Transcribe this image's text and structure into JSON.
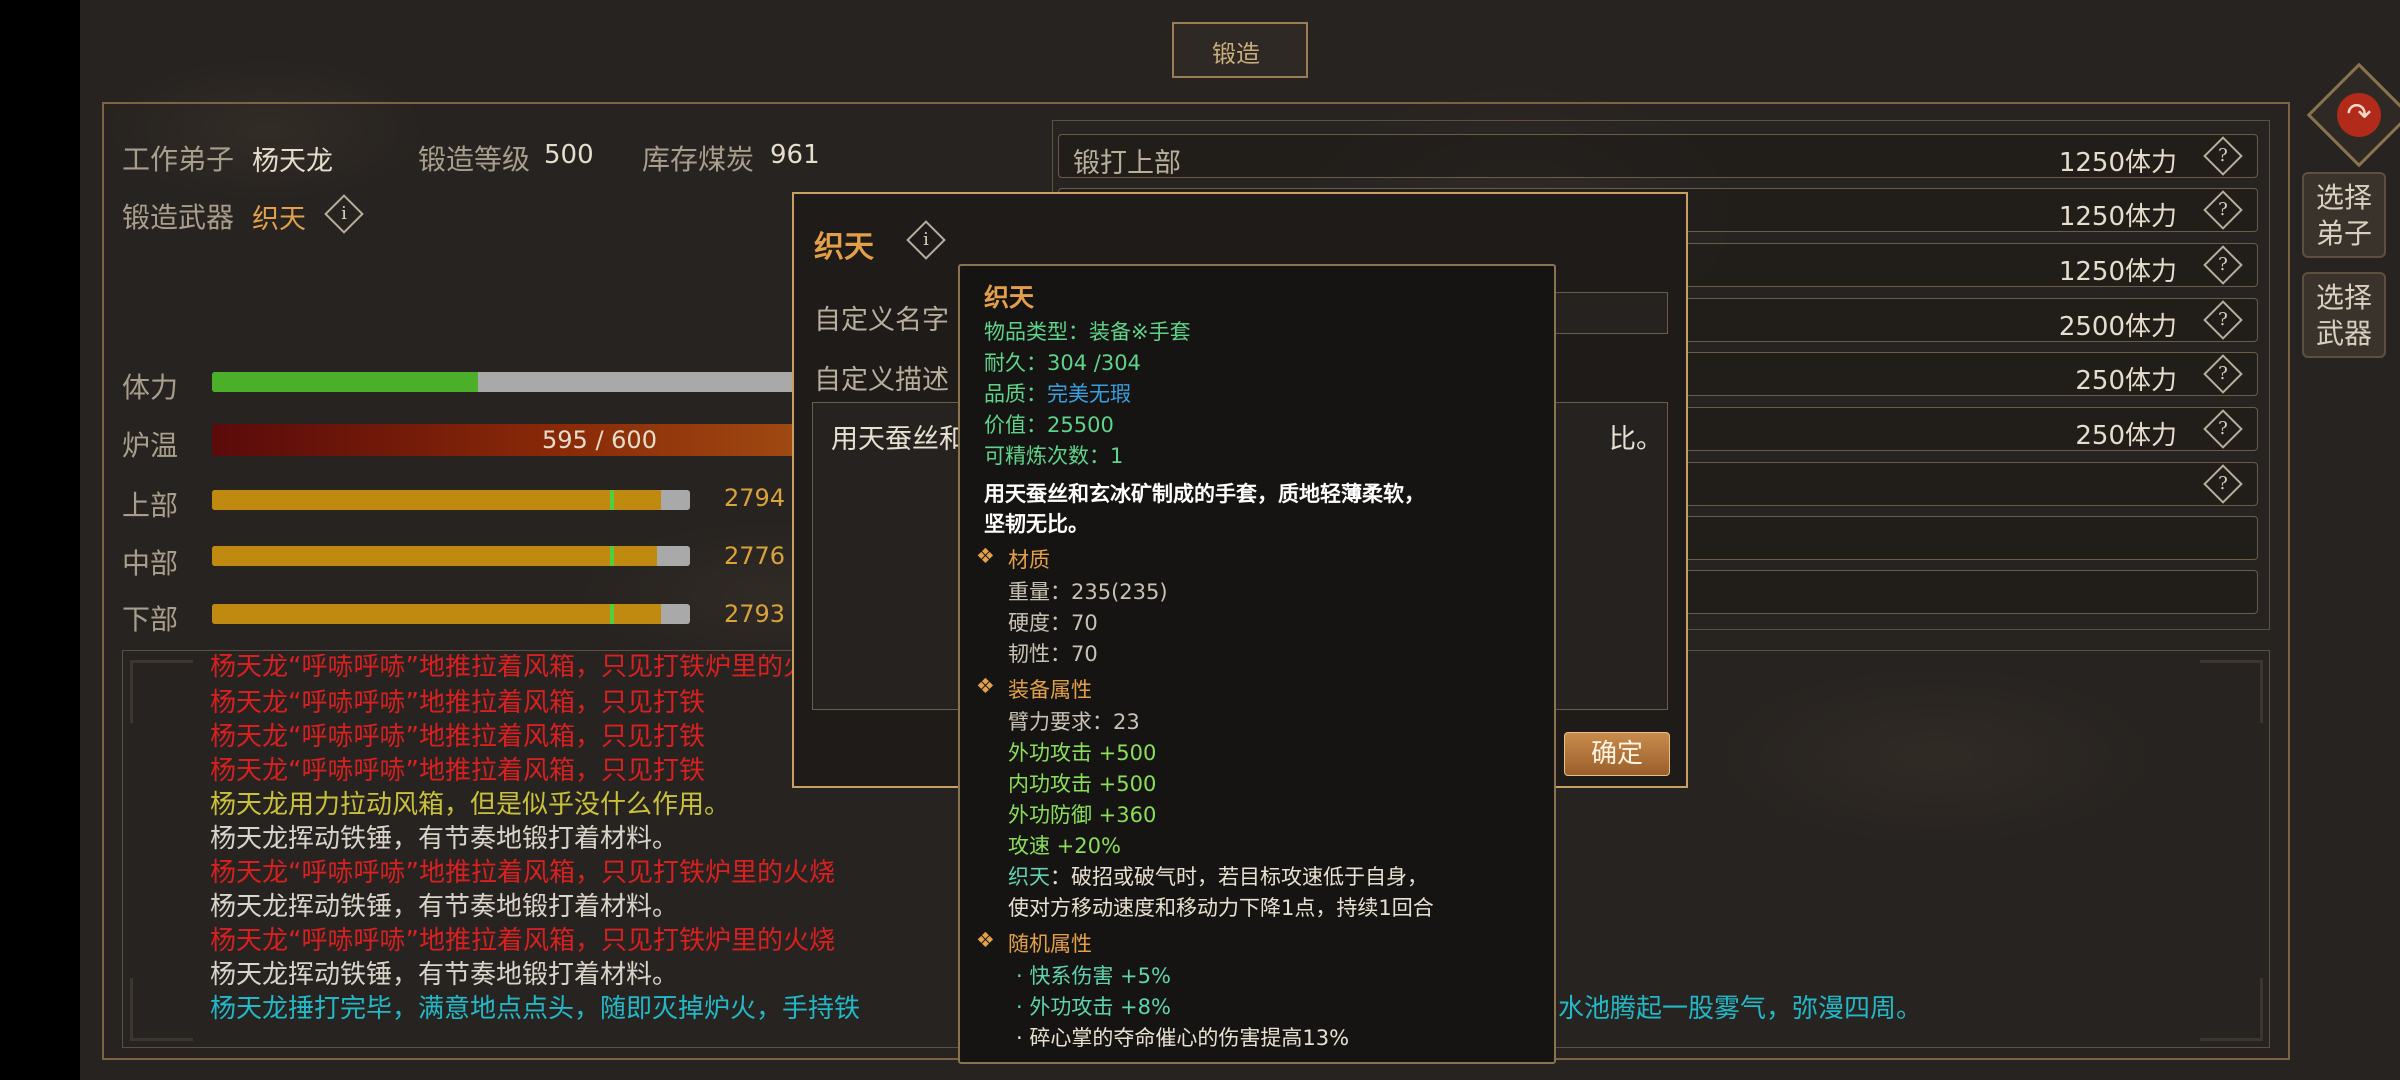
{
  "header": {
    "title": "锻造"
  },
  "info": {
    "worker_label": "工作弟子",
    "worker_value": "杨天龙",
    "level_label": "锻造等级",
    "level_value": "500",
    "coal_label": "库存煤炭",
    "coal_value": "961",
    "weapon_label": "锻造武器",
    "weapon_value": "织天"
  },
  "stats": {
    "stamina": {
      "label": "体力",
      "fraction": 0.45
    },
    "furnace": {
      "label": "炉温",
      "text": "595 / 600",
      "current": 595,
      "max": 600
    },
    "upper": {
      "label": "上部",
      "value": "2794",
      "fraction": 0.94
    },
    "middle": {
      "label": "中部",
      "value": "2776",
      "fraction": 0.93
    },
    "lower": {
      "label": "下部",
      "value": "2793",
      "fraction": 0.94
    }
  },
  "recipes": [
    {
      "name": "锻打上部",
      "cost": "1250体力"
    },
    {
      "name": "",
      "cost": "1250体力"
    },
    {
      "name": "",
      "cost": "1250体力"
    },
    {
      "name": "",
      "cost": "2500体力"
    },
    {
      "name": "",
      "cost": "250体力"
    },
    {
      "name": "",
      "cost": "250体力"
    },
    {
      "name": "",
      "cost": ""
    }
  ],
  "side_buttons": {
    "select_disciple": "选择弟子",
    "select_weapon": "选择武器"
  },
  "log": [
    {
      "text": "杨天龙“呼哧呼哧”地推拉着风箱，只见打铁炉里的火",
      "color": "red"
    },
    {
      "text": "杨天龙“呼哧呼哧”地推拉着风箱，只见打铁",
      "color": "red"
    },
    {
      "text": "杨天龙“呼哧呼哧”地推拉着风箱，只见打铁",
      "color": "red"
    },
    {
      "text": "杨天龙“呼哧呼哧”地推拉着风箱，只见打铁",
      "color": "red"
    },
    {
      "text": "杨天龙用力拉动风箱，但是似乎没什么作用。",
      "color": "yellow"
    },
    {
      "text": "杨天龙挥动铁锤，有节奏地锻打着材料。",
      "color": "white"
    },
    {
      "text": "杨天龙“呼哧呼哧”地推拉着风箱，只见打铁炉里的火烧",
      "color": "red"
    },
    {
      "text": "杨天龙挥动铁锤，有节奏地锻打着材料。",
      "color": "white"
    },
    {
      "text": "杨天龙“呼哧呼哧”地推拉着风箱，只见打铁炉里的火烧",
      "color": "red"
    },
    {
      "text": "杨天龙挥动铁锤，有节奏地锻打着材料。",
      "color": "white"
    },
    {
      "text": "杨天龙捶打完毕，满意地点点头，随即灭掉炉火，手持铁",
      "color": "cyan"
    },
    {
      "text": "水池腾起一股雾气，弥漫四周。",
      "color": "cyan"
    }
  ],
  "modal": {
    "title": "织天",
    "custom_name_label": "自定义名字",
    "custom_desc_label": "自定义描述",
    "desc_text": "用天蚕丝和",
    "desc_tail": "比。",
    "confirm": "确定"
  },
  "tooltip": {
    "name": "织天",
    "type_label": "物品类型：",
    "type_value": "装备※手套",
    "durability_label": "耐久：",
    "durability_value": "304 /304",
    "quality_label": "品质：",
    "quality_value": "完美无瑕",
    "price_label": "价值：",
    "price_value": "25500",
    "refine_label": "可精炼次数：",
    "refine_value": "1",
    "desc_line1": "用天蚕丝和玄冰矿制成的手套，质地轻薄柔软，",
    "desc_line2": "坚韧无比。",
    "material_header": "材质",
    "weight": "重量：235(235)",
    "hardness": "硬度：70",
    "toughness": "韧性：70",
    "equip_header": "装备属性",
    "arm_req": "臂力要求：23",
    "outer_attack": "外功攻击 +500",
    "inner_attack": "内功攻击 +500",
    "outer_defense": "外功防御 +360",
    "attack_speed": "攻速 +20%",
    "special_name": "织天",
    "special_line1": "：破招或破气时，若目标攻速低于自身，",
    "special_line2": "使对方移动速度和移动力下降1点，持续1回合",
    "random_header": "随机属性",
    "rand1": "· 快系伤害 +5%",
    "rand2": "· 外功攻击 +8%",
    "rand3": "· 碎心掌的夺命催心的伤害提高13%"
  },
  "colors": {
    "accent": "#e2a04a",
    "frame": "#7a6444",
    "stamina": "#4caf2a",
    "gold_bar": "#c08a10"
  }
}
